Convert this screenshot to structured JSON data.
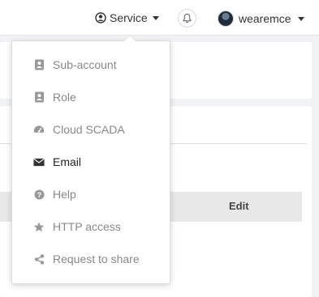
{
  "header": {
    "service_label": "Service",
    "username": "wearemce"
  },
  "table": {
    "edit_header": "Edit"
  },
  "service_menu": {
    "items": [
      {
        "label": "Sub-account",
        "icon": "contact-card-icon",
        "active": false
      },
      {
        "label": "Role",
        "icon": "contact-card-icon",
        "active": false
      },
      {
        "label": "Cloud SCADA",
        "icon": "dashboard-gauge-icon",
        "active": false
      },
      {
        "label": "Email",
        "icon": "envelope-icon",
        "active": true
      },
      {
        "label": "Help",
        "icon": "question-circle-icon",
        "active": false
      },
      {
        "label": "HTTP access",
        "icon": "star-icon",
        "active": false
      },
      {
        "label": "Request to share",
        "icon": "share-icon",
        "active": false
      }
    ]
  },
  "colors": {
    "menu_text": "#888888",
    "menu_text_active": "#222222",
    "icon": "#999999",
    "icon_active": "#333333"
  }
}
